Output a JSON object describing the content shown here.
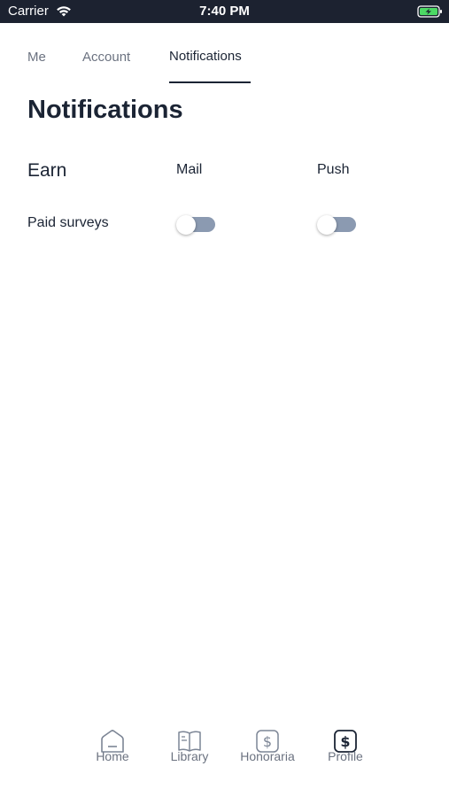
{
  "status_bar": {
    "carrier": "Carrier",
    "time": "7:40 PM"
  },
  "tabs": [
    {
      "label": "Me",
      "active": false
    },
    {
      "label": "Account",
      "active": false
    },
    {
      "label": "Notifications",
      "active": true
    }
  ],
  "page": {
    "title": "Notifications"
  },
  "settings": {
    "section": "Earn",
    "columns": [
      "Mail",
      "Push"
    ],
    "rows": [
      {
        "label": "Paid surveys",
        "mail_enabled": false,
        "push_enabled": false
      }
    ]
  },
  "bottom_nav": [
    {
      "label": "Home",
      "icon": "home-icon",
      "active": false
    },
    {
      "label": "Library",
      "icon": "book-icon",
      "active": false
    },
    {
      "label": "Honoraria",
      "icon": "dollar-icon",
      "active": false
    },
    {
      "label": "Profile",
      "icon": "profile-dollar-icon",
      "active": true
    }
  ],
  "colors": {
    "status_bar_bg": "#1c2230",
    "text_primary": "#1b2434",
    "text_muted": "#6b7280",
    "toggle_track": "#8b9ab1",
    "battery_green": "#4cd964"
  }
}
